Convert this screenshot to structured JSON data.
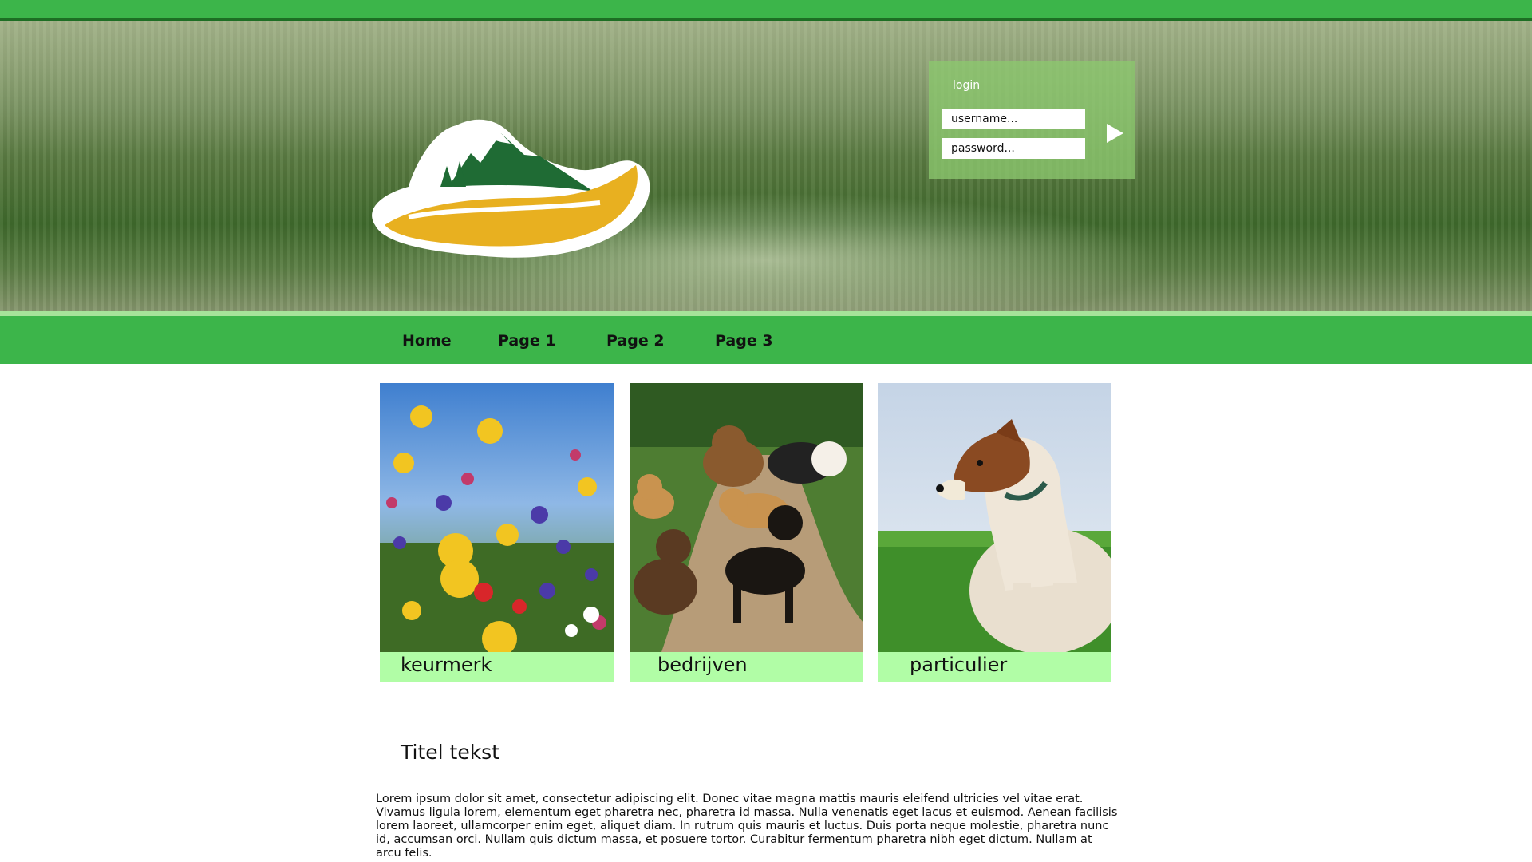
{
  "login": {
    "title": "login",
    "username_placeholder": "username...",
    "password_placeholder": "password..."
  },
  "nav": {
    "items": [
      {
        "label": "Home"
      },
      {
        "label": "Page 1"
      },
      {
        "label": "Page 2"
      },
      {
        "label": "Page 3"
      }
    ]
  },
  "cards": [
    {
      "label": "keurmerk",
      "image": "wildflower-meadow"
    },
    {
      "label": "bedrijven",
      "image": "dogs-on-path"
    },
    {
      "label": "particulier",
      "image": "terrier-in-grass"
    }
  ],
  "content": {
    "title": "Titel tekst",
    "body": "Lorem ipsum dolor sit amet, consectetur adipiscing elit. Donec vitae magna mattis mauris eleifend ultricies vel vitae erat. Vivamus ligula lorem, elementum eget pharetra nec, pharetra id massa. Nulla venenatis eget lacus et euismod. Aenean facilisis lorem laoreet, ullamcorper enim eget, aliquet diam. In rutrum quis mauris et luctus. Duis porta neque molestie, pharetra nunc id, accumsan orci. Nullam quis dictum massa, et posuere tortor. Curabitur fermentum pharetra nibh eget dictum. Nullam at arcu felis."
  },
  "colors": {
    "brand_green": "#3cb54a",
    "caption_green": "#b1fda6",
    "logo_green": "#1f6b34",
    "logo_yellow": "#e8b020"
  }
}
